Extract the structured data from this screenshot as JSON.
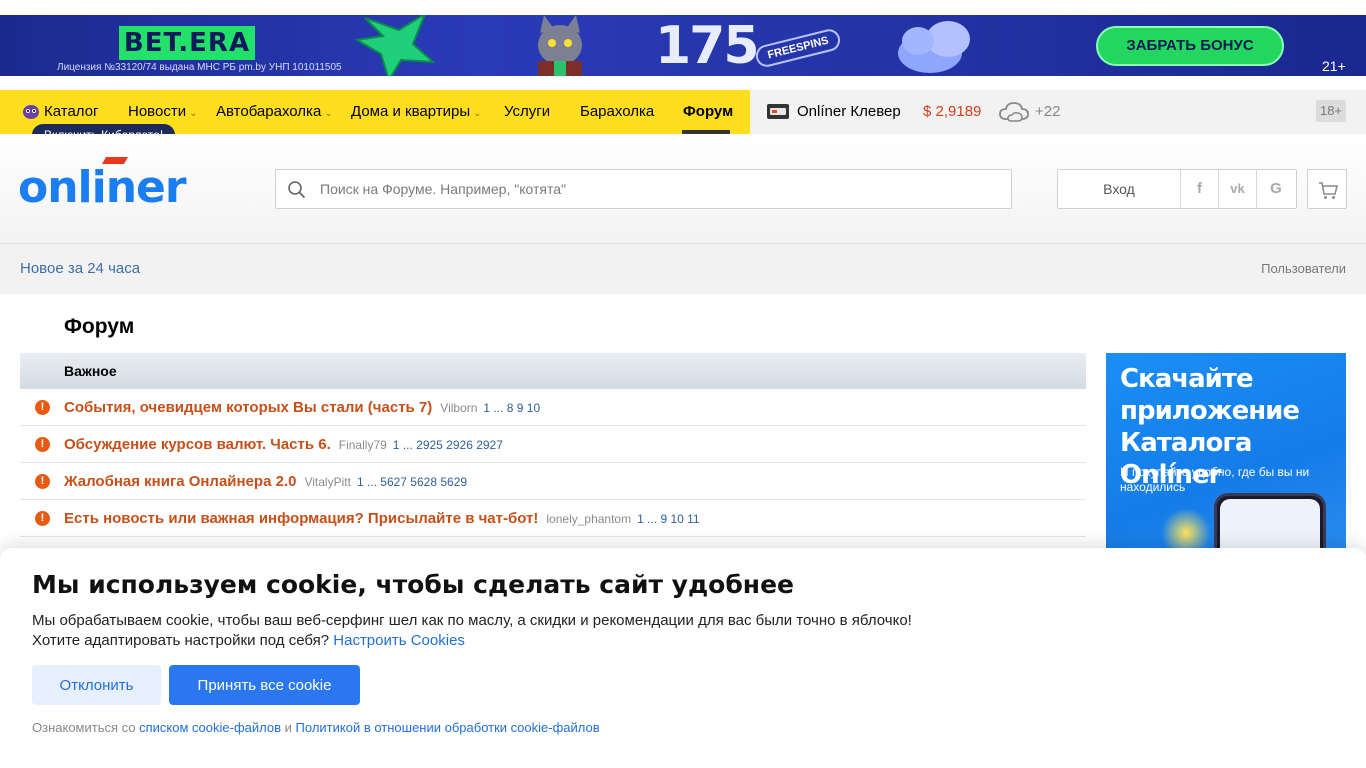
{
  "ad_banner": {
    "brand": "BET.ERA",
    "license": "Лицензия №33120/74 выдана МНС РБ pm.by УНП 101011505",
    "number": "175",
    "freespins": "FREESPINS",
    "cta": "ЗАБРАТЬ БОНУС",
    "age": "21+"
  },
  "nav": {
    "items": [
      {
        "label": "Каталог"
      },
      {
        "label": "Новости"
      },
      {
        "label": "Автобарахолка"
      },
      {
        "label": "Дома и квартиры"
      },
      {
        "label": "Услуги"
      },
      {
        "label": "Барахолка"
      },
      {
        "label": "Форум"
      }
    ],
    "active": "Форум",
    "cyber_badge": "Включить Киберлето!",
    "klever": "Onlíner Клевер",
    "usd_rate": "$ 2,9189",
    "temperature": "+22",
    "age": "18+"
  },
  "header": {
    "logo": "onliner",
    "search_placeholder": "Поиск на Форуме. Например, \"котята\"",
    "login": "Вход",
    "social": [
      "f",
      "vk",
      "G"
    ]
  },
  "subnav": {
    "new24": "Новое за 24 часа",
    "users": "Пользователи"
  },
  "forum": {
    "title": "Форум",
    "section": "Важное",
    "topics": [
      {
        "title": "События, очевидцем которых Вы стали (часть 7)",
        "author": "Vilborn",
        "pages": "1 ... 8 9 10"
      },
      {
        "title": "Обсуждение курсов валют. Часть 6.",
        "author": "Finally79",
        "pages": "1 ... 2925 2926 2927"
      },
      {
        "title": "Жалобная книга Онлайнера 2.0",
        "author": "VitalyPitt",
        "pages": "1 ... 5627 5628 5629"
      },
      {
        "title": "Есть новость или важная информация? Присылайте в чат-бот!",
        "author": "lonely_phantom",
        "pages": "1 ... 9 10 11"
      }
    ]
  },
  "app_ad": {
    "title": "Скачайте приложение Каталога Onlíner",
    "subtitle": "И покупайте удобно, где бы вы ни находились"
  },
  "cookie": {
    "title": "Мы используем cookie, чтобы сделать сайт удобнее",
    "text1": "Мы обрабатываем cookie, чтобы ваш веб-серфинг шел как по маслу, а скидки и рекомендации для вас были точно в яблочко!",
    "text2": "Хотите адаптировать настройки под себя?",
    "settings_link": "Настроить Cookies",
    "decline": "Отклонить",
    "accept": "Принять все cookie",
    "foot_prefix": "Ознакомиться со",
    "foot_link1": "списком cookie-файлов",
    "foot_and": "и",
    "foot_link2": "Политикой в отношении обработки cookie-файлов"
  },
  "colors": {
    "nav_yellow": "#ffde1d",
    "brand_blue": "#1a7df0",
    "topic_orange": "#c7501a",
    "usd_red": "#d93b18",
    "accept_blue": "#2a77f0"
  }
}
